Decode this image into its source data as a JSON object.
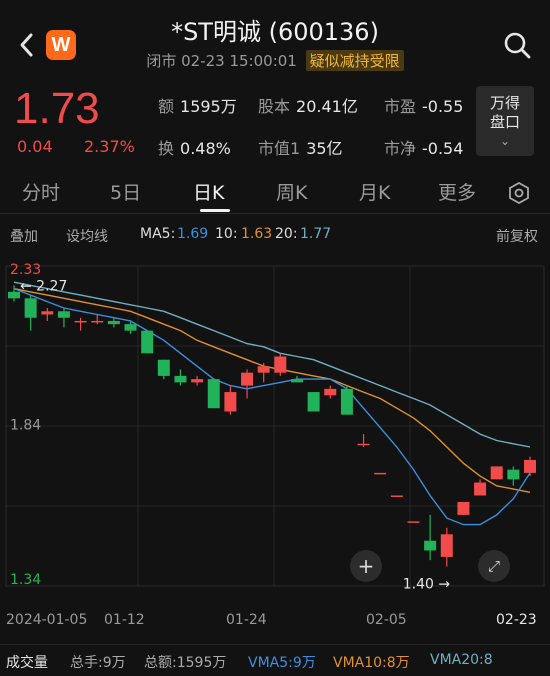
{
  "header": {
    "title": "*ST明诚 (600136)",
    "status": "闭市 02-23 15:00:01",
    "warning": "疑似减持受限",
    "logo_letter": "W"
  },
  "quote": {
    "price": "1.73",
    "change": "0.04",
    "change_pct": "2.37%",
    "stats": [
      {
        "key": "额",
        "value": "1595万"
      },
      {
        "key": "股本",
        "value": "20.41亿"
      },
      {
        "key": "市盈",
        "value": "-0.55"
      },
      {
        "key": "换",
        "value": "0.48%"
      },
      {
        "key": "市值1",
        "value": "35亿"
      },
      {
        "key": "市净",
        "value": "-0.54"
      }
    ],
    "unit_button": [
      "万得",
      "盘口"
    ]
  },
  "tabs": [
    {
      "label": "分时",
      "active": false
    },
    {
      "label": "5日",
      "active": false
    },
    {
      "label": "日K",
      "active": true
    },
    {
      "label": "周K",
      "active": false
    },
    {
      "label": "月K",
      "active": false
    },
    {
      "label": "更多",
      "active": false
    }
  ],
  "ma_row": {
    "overlay": "叠加",
    "set_ma": "设均线",
    "ma5_label": "MA5:",
    "ma5_value": "1.69",
    "ma10_label": "10:",
    "ma10_value": "1.63",
    "ma20_label": "20:",
    "ma20_value": "1.77",
    "adjust": "前复权"
  },
  "colors": {
    "up": "#f24b4b",
    "down": "#22b35a",
    "ma5": "#3d8fe0",
    "ma10": "#e0902f",
    "ma20": "#6fb0c0"
  },
  "chart_data": {
    "type": "candlestick",
    "ylim": [
      1.34,
      2.33
    ],
    "y_ticks": [
      "2.33",
      "1.84",
      "1.34"
    ],
    "high_marker": "2.27",
    "low_marker": "1.40",
    "x_tick_labels": [
      "2024-01-05",
      "01-12",
      "01-24",
      "02-05",
      "02-23"
    ],
    "candles": [
      {
        "o": 2.25,
        "h": 2.27,
        "l": 2.22,
        "c": 2.23
      },
      {
        "o": 2.23,
        "h": 2.24,
        "l": 2.13,
        "c": 2.17
      },
      {
        "o": 2.18,
        "h": 2.2,
        "l": 2.16,
        "c": 2.19
      },
      {
        "o": 2.19,
        "h": 2.2,
        "l": 2.14,
        "c": 2.17
      },
      {
        "o": 2.16,
        "h": 2.17,
        "l": 2.13,
        "c": 2.16
      },
      {
        "o": 2.16,
        "h": 2.18,
        "l": 2.15,
        "c": 2.16
      },
      {
        "o": 2.16,
        "h": 2.17,
        "l": 2.14,
        "c": 2.15
      },
      {
        "o": 2.15,
        "h": 2.16,
        "l": 2.12,
        "c": 2.13
      },
      {
        "o": 2.13,
        "h": 2.13,
        "l": 2.06,
        "c": 2.06
      },
      {
        "o": 2.04,
        "h": 2.04,
        "l": 1.98,
        "c": 1.99
      },
      {
        "o": 1.99,
        "h": 2.01,
        "l": 1.96,
        "c": 1.97
      },
      {
        "o": 1.97,
        "h": 1.99,
        "l": 1.96,
        "c": 1.98
      },
      {
        "o": 1.98,
        "h": 1.98,
        "l": 1.89,
        "c": 1.89
      },
      {
        "o": 1.88,
        "h": 1.96,
        "l": 1.87,
        "c": 1.94
      },
      {
        "o": 1.96,
        "h": 2.01,
        "l": 1.92,
        "c": 2.0
      },
      {
        "o": 2.0,
        "h": 2.03,
        "l": 1.97,
        "c": 2.02
      },
      {
        "o": 2.0,
        "h": 2.06,
        "l": 1.99,
        "c": 2.05
      },
      {
        "o": 1.98,
        "h": 1.99,
        "l": 1.97,
        "c": 1.97
      },
      {
        "o": 1.94,
        "h": 1.94,
        "l": 1.88,
        "c": 1.88
      },
      {
        "o": 1.93,
        "h": 1.96,
        "l": 1.92,
        "c": 1.95
      },
      {
        "o": 1.95,
        "h": 1.96,
        "l": 1.87,
        "c": 1.87
      },
      {
        "o": 1.78,
        "h": 1.81,
        "l": 1.77,
        "c": 1.78
      },
      {
        "o": 1.69,
        "h": 1.69,
        "l": 1.69,
        "c": 1.69
      },
      {
        "o": 1.62,
        "h": 1.62,
        "l": 1.62,
        "c": 1.62
      },
      {
        "o": 1.54,
        "h": 1.54,
        "l": 1.54,
        "c": 1.54
      },
      {
        "o": 1.48,
        "h": 1.56,
        "l": 1.42,
        "c": 1.45
      },
      {
        "o": 1.43,
        "h": 1.52,
        "l": 1.4,
        "c": 1.5
      },
      {
        "o": 1.56,
        "h": 1.6,
        "l": 1.56,
        "c": 1.6
      },
      {
        "o": 1.62,
        "h": 1.67,
        "l": 1.62,
        "c": 1.66
      },
      {
        "o": 1.67,
        "h": 1.71,
        "l": 1.67,
        "c": 1.71
      },
      {
        "o": 1.7,
        "h": 1.71,
        "l": 1.65,
        "c": 1.67
      },
      {
        "o": 1.69,
        "h": 1.74,
        "l": 1.68,
        "c": 1.73
      }
    ],
    "ma5": [
      2.26,
      2.24,
      2.22,
      2.2,
      2.19,
      2.18,
      2.17,
      2.16,
      2.13,
      2.1,
      2.06,
      2.02,
      1.98,
      1.96,
      1.95,
      1.96,
      1.97,
      1.98,
      1.98,
      1.98,
      1.95,
      1.89,
      1.83,
      1.77,
      1.7,
      1.62,
      1.55,
      1.53,
      1.53,
      1.56,
      1.61,
      1.69
    ],
    "ma10": [
      2.26,
      2.25,
      2.24,
      2.23,
      2.22,
      2.21,
      2.2,
      2.19,
      2.17,
      2.15,
      2.13,
      2.1,
      2.08,
      2.06,
      2.04,
      2.02,
      2.01,
      2.0,
      1.99,
      1.98,
      1.96,
      1.94,
      1.92,
      1.89,
      1.86,
      1.82,
      1.77,
      1.72,
      1.68,
      1.65,
      1.64,
      1.63
    ],
    "ma20": [
      2.28,
      2.27,
      2.26,
      2.25,
      2.24,
      2.23,
      2.22,
      2.21,
      2.2,
      2.19,
      2.17,
      2.15,
      2.13,
      2.11,
      2.09,
      2.08,
      2.06,
      2.05,
      2.04,
      2.02,
      2.0,
      1.98,
      1.96,
      1.94,
      1.92,
      1.9,
      1.87,
      1.84,
      1.81,
      1.79,
      1.78,
      1.77
    ]
  },
  "volume_row": {
    "title": "成交量",
    "total_hands": "总手:9万",
    "total_amount": "总额:1595万",
    "vma5": "VMA5:9万",
    "vma10": "VMA10:8万",
    "vma20": "VMA20:8"
  }
}
